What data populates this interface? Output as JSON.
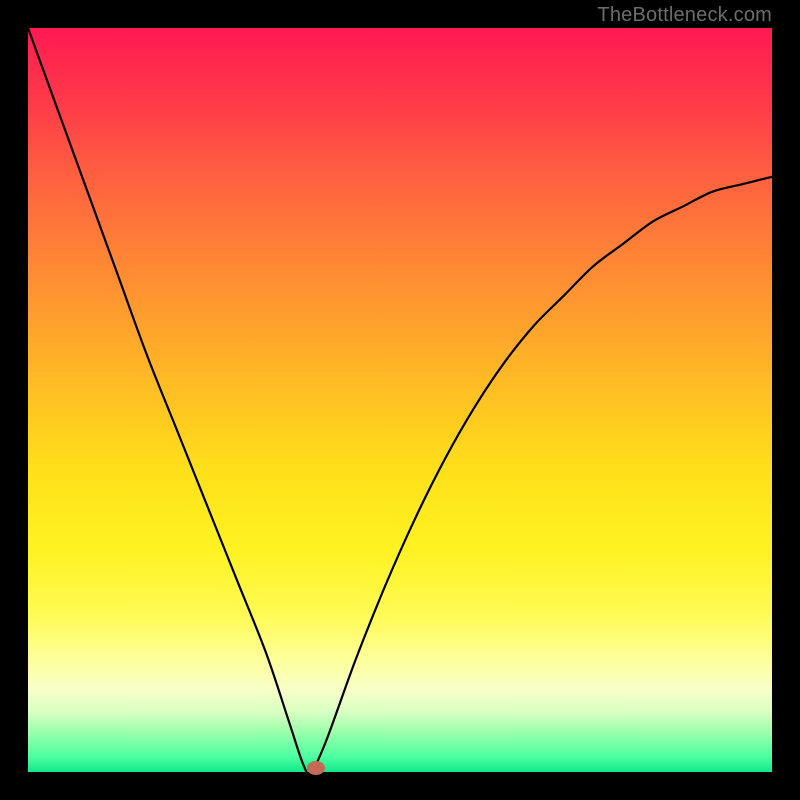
{
  "watermark": "TheBottleneck.com",
  "colors": {
    "frame": "#000000",
    "curve": "#000000",
    "marker": "#c46a55",
    "gradient_top": "#ff1a52",
    "gradient_bottom": "#12e88a"
  },
  "chart_data": {
    "type": "line",
    "title": "",
    "xlabel": "",
    "ylabel": "",
    "xlim": [
      0,
      100
    ],
    "ylim": [
      0,
      100
    ],
    "grid": false,
    "legend": false,
    "note": "Chart has no visible tick labels; values estimated from pixel positions. Lower y = better (green). Curve is V-shaped with minimum near x≈38.",
    "x": [
      0,
      4,
      8,
      12,
      16,
      20,
      24,
      28,
      32,
      35,
      37,
      38,
      40,
      44,
      48,
      52,
      56,
      60,
      64,
      68,
      72,
      76,
      80,
      84,
      88,
      92,
      96,
      100
    ],
    "y": [
      100,
      89,
      78,
      67,
      56,
      46,
      36,
      26,
      16,
      7,
      1,
      0,
      4,
      15,
      25,
      34,
      42,
      49,
      55,
      60,
      64,
      68,
      71,
      74,
      76,
      78,
      79,
      80
    ],
    "marker": {
      "x": 38.7,
      "y": 0.0
    }
  }
}
